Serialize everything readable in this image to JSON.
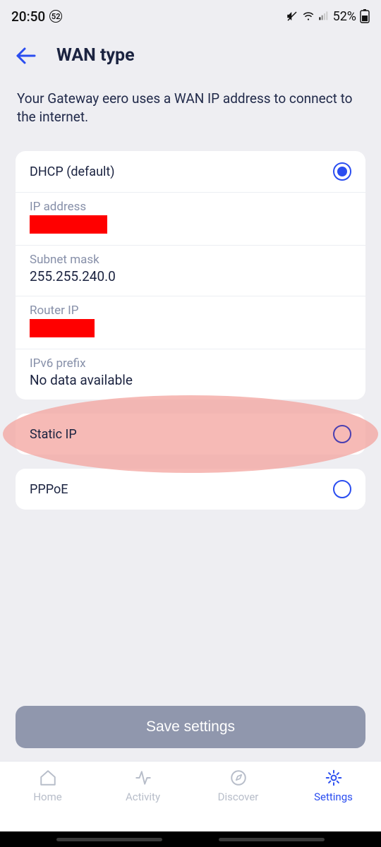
{
  "status_bar": {
    "time": "20:50",
    "badge": "52",
    "battery_pct": "52%"
  },
  "header": {
    "title": "WAN type"
  },
  "description": "Your Gateway eero uses a WAN IP address to connect to the internet.",
  "wan_options": {
    "dhcp": {
      "label": "DHCP (default)",
      "selected": true,
      "details": {
        "ip_label": "IP address",
        "ip_value": "",
        "subnet_label": "Subnet mask",
        "subnet_value": "255.255.240.0",
        "router_label": "Router IP",
        "router_value": "",
        "ipv6_label": "IPv6 prefix",
        "ipv6_value": "No data available"
      }
    },
    "static": {
      "label": "Static IP",
      "selected": false,
      "highlighted": true
    },
    "pppoe": {
      "label": "PPPoE",
      "selected": false
    }
  },
  "save_button_label": "Save settings",
  "bottom_nav": {
    "home": "Home",
    "activity": "Activity",
    "discover": "Discover",
    "settings": "Settings",
    "active": "settings"
  }
}
